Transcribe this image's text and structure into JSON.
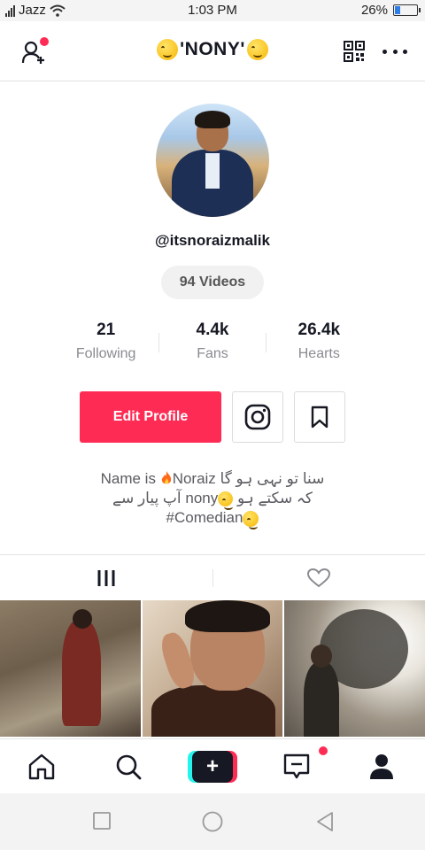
{
  "status_bar": {
    "carrier": "Jazz",
    "time": "1:03 PM",
    "battery_percent": "26%",
    "battery_level": 0.26
  },
  "header": {
    "title": "'NONY'",
    "title_emoji": "winking-tongue-face",
    "icons": [
      "add-user-icon",
      "qr-code-icon",
      "more-icon"
    ],
    "notification_dot_color": "#fe2c55"
  },
  "profile": {
    "username": "@itsnoraizmalik",
    "videos_label": "94 Videos",
    "stats": [
      {
        "value": "21",
        "label": "Following"
      },
      {
        "value": "4.4k",
        "label": "Fans"
      },
      {
        "value": "26.4k",
        "label": "Hearts"
      }
    ],
    "edit_button": "Edit Profile",
    "accent_color": "#fe2c55",
    "bio": {
      "line1_prefix": "Name is ",
      "line1_suffix": "Noraiz سنا تو نہی ہو گا",
      "line2_a": "آپ پیار سے ",
      "line2_b": "nony",
      "line2_c": " کہ سکتے ہو",
      "line3": "#Comedian"
    }
  },
  "tabs": {
    "items": [
      "videos-grid-icon",
      "liked-heart-icon"
    ]
  },
  "videos": [
    {
      "name": "video-thumb-1"
    },
    {
      "name": "video-thumb-2"
    },
    {
      "name": "video-thumb-3"
    }
  ],
  "bottom_nav": {
    "items": [
      "home-icon",
      "discover-search-icon",
      "create-plus-icon",
      "inbox-icon",
      "me-profile-icon"
    ],
    "create_label": "+"
  },
  "system_nav": {
    "items": [
      "recent-apps-icon",
      "home-circle-icon",
      "back-triangle-icon"
    ]
  }
}
